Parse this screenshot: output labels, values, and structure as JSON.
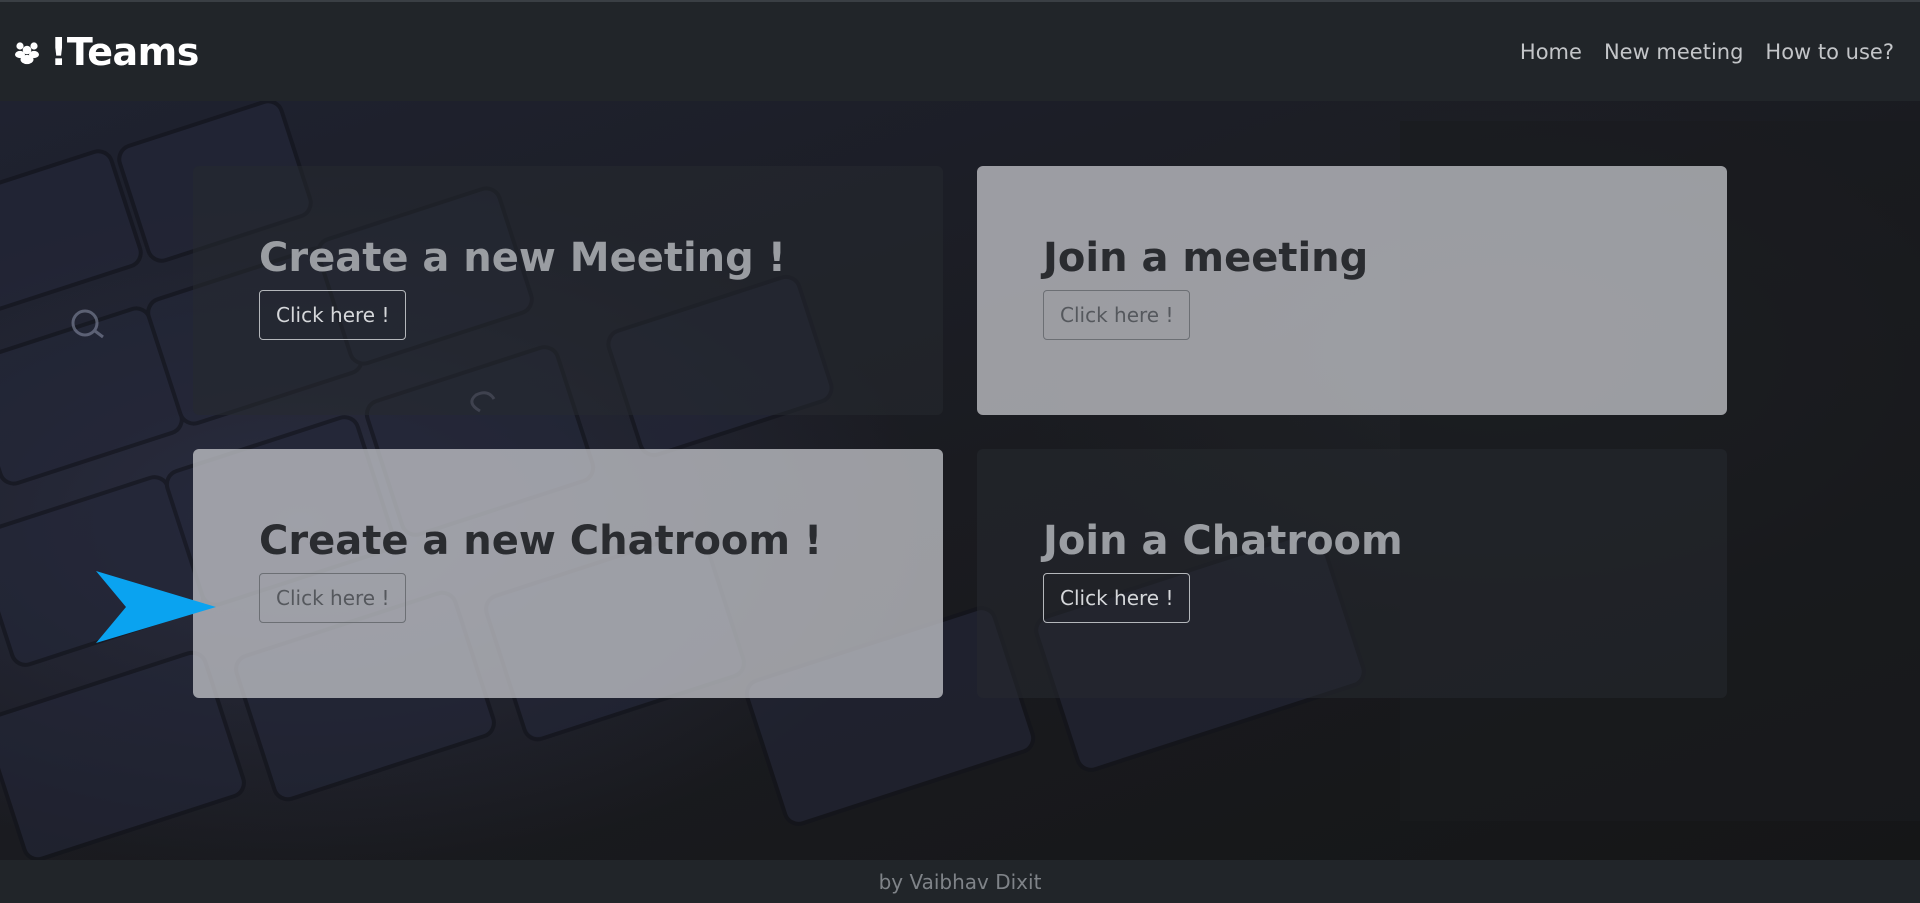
{
  "navbar": {
    "brand_icon": "users-icon",
    "brand_title": "!Teams",
    "links": [
      "Home",
      "New meeting",
      "How to use?"
    ]
  },
  "cards": [
    {
      "title": "Create a new Meeting !",
      "button": "Click here !",
      "style": "dark"
    },
    {
      "title": "Join a meeting",
      "button": "Click here !",
      "style": "light"
    },
    {
      "title": "Create a new Chatroom !",
      "button": "Click here !",
      "style": "light"
    },
    {
      "title": "Join a Chatroom",
      "button": "Click here !",
      "style": "dark"
    }
  ],
  "pointer": {
    "icon": "arrow-pointer-icon",
    "color": "#0aa3f0"
  },
  "footer": {
    "text": "by Vaibhav Dixit"
  },
  "colors": {
    "navbar": "#212529",
    "accent": "#0aa3f0"
  }
}
